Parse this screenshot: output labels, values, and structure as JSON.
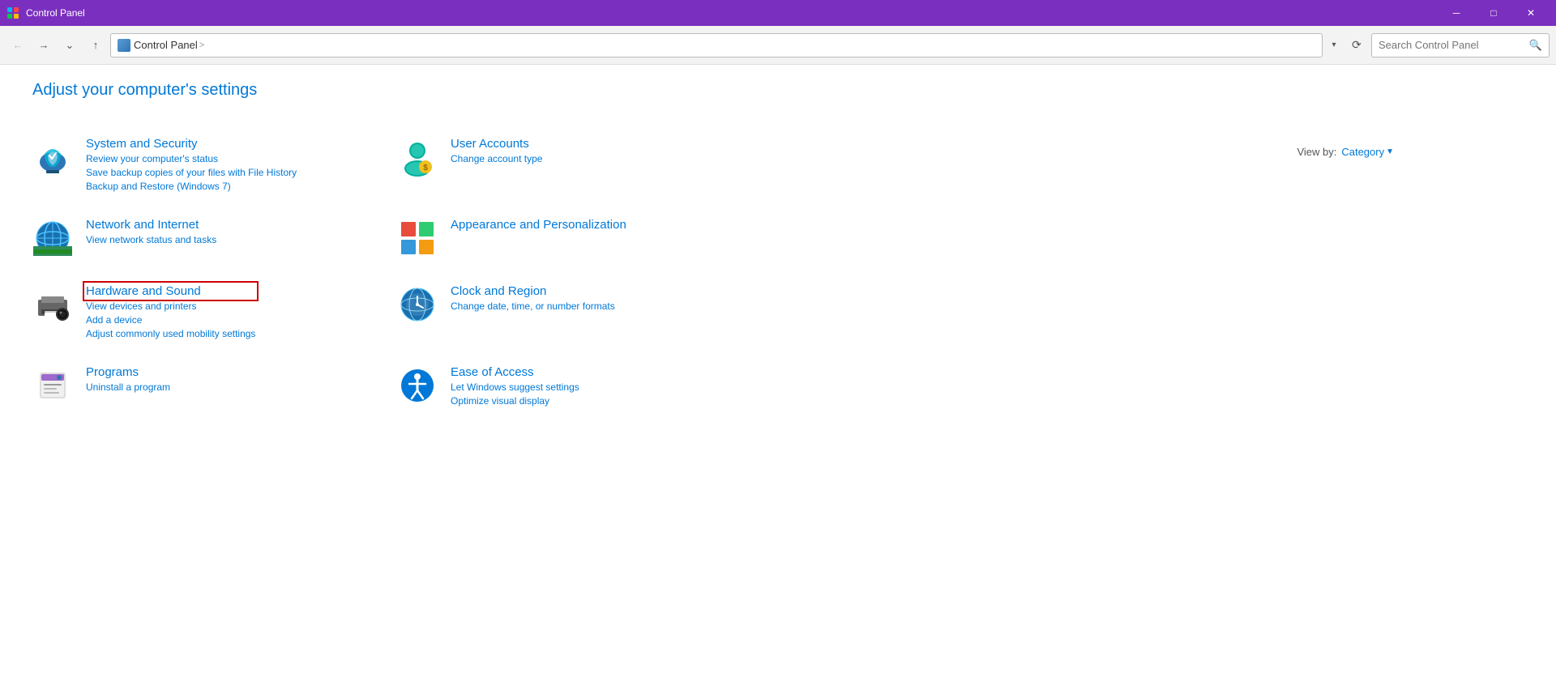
{
  "titlebar": {
    "title": "Control Panel",
    "minimize_label": "─",
    "maximize_label": "□",
    "close_label": "✕"
  },
  "addressbar": {
    "back_tooltip": "Back",
    "forward_tooltip": "Forward",
    "down_tooltip": "Recent",
    "up_tooltip": "Up",
    "path_icon": "control-panel-icon",
    "path_root": "Control Panel",
    "path_sep": ">",
    "search_placeholder": "Search Control Panel"
  },
  "main": {
    "page_title": "Adjust your computer's settings",
    "view_by_label": "View by:",
    "view_by_value": "Category",
    "categories": [
      {
        "id": "system-security",
        "title": "System and Security",
        "links": [
          "Review your computer's status",
          "Save backup copies of your files with File History",
          "Backup and Restore (Windows 7)"
        ],
        "highlighted": false
      },
      {
        "id": "user-accounts",
        "title": "User Accounts",
        "links": [
          "Change account type"
        ],
        "highlighted": false
      },
      {
        "id": "network-internet",
        "title": "Network and Internet",
        "links": [
          "View network status and tasks"
        ],
        "highlighted": false
      },
      {
        "id": "appearance-personalization",
        "title": "Appearance and Personalization",
        "links": [],
        "highlighted": false
      },
      {
        "id": "hardware-sound",
        "title": "Hardware and Sound",
        "links": [
          "View devices and printers",
          "Add a device",
          "Adjust commonly used mobility settings"
        ],
        "highlighted": true
      },
      {
        "id": "clock-region",
        "title": "Clock and Region",
        "links": [
          "Change date, time, or number formats"
        ],
        "highlighted": false
      },
      {
        "id": "programs",
        "title": "Programs",
        "links": [
          "Uninstall a program"
        ],
        "highlighted": false
      },
      {
        "id": "ease-of-access",
        "title": "Ease of Access",
        "links": [
          "Let Windows suggest settings",
          "Optimize visual display"
        ],
        "highlighted": false
      }
    ]
  }
}
